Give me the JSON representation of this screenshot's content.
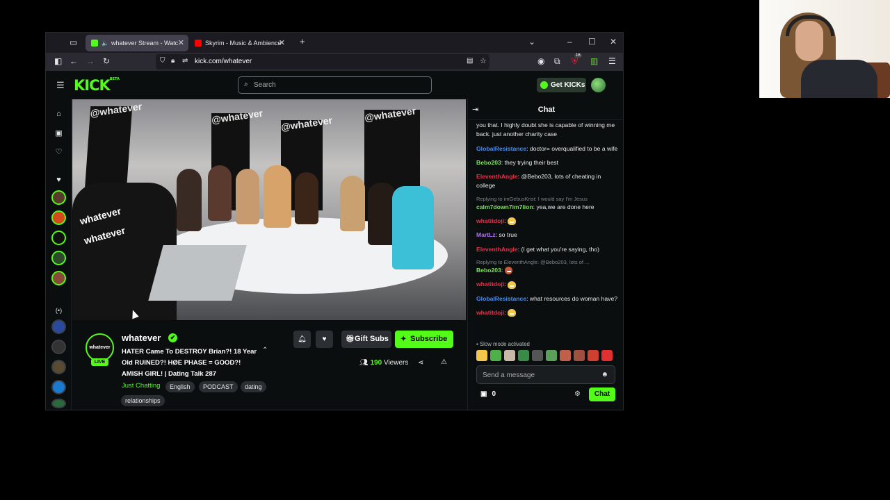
{
  "browser": {
    "tabs": [
      {
        "title": "whatever Stream - Watch L",
        "favicon_color": "#53fc18",
        "active": true
      },
      {
        "title": "Skyrim - Music & Ambience - N",
        "favicon_color": "#ff0000",
        "active": false
      }
    ],
    "new_tab_label": "+",
    "url": "kick.com/whatever",
    "extension_badge": "16"
  },
  "kick": {
    "logo": "KICK",
    "logo_tag": "BETA",
    "search_placeholder": "Search",
    "get_kicks_label": "Get KICKs"
  },
  "video_overlay": {
    "wall_text": "@whatever"
  },
  "channel": {
    "avatar_text": "whatever",
    "live_label": "LIVE",
    "name": "whatever",
    "verified_glyph": "✔",
    "title": "HATER Came To DESTROY Brian?! 18 Year Old RUINED?! HØE PHASE = GOOD?! AMISH GIRL! | Dating Talk 287",
    "category": "Just Chatting",
    "tags": [
      "English",
      "PODCAST",
      "dating",
      "relationships"
    ],
    "viewers_count": "190",
    "viewers_label": "Viewers",
    "gift_subs_label": "Gift Subs",
    "subscribe_label": "Subscribe"
  },
  "chat": {
    "title": "Chat",
    "messages": [
      {
        "reply": "",
        "user": "",
        "user_color": "#e8eaea",
        "text": "you that. I highly doubt she is capable of winning me back. just another charity case",
        "emote": false
      },
      {
        "reply": "",
        "user": "GlobalResistance",
        "user_color": "#4d8ff0",
        "text": "doctor= overqualified to be a wife",
        "emote": false
      },
      {
        "reply": "",
        "user": "Bebo203",
        "user_color": "#7fe05c",
        "text": "they trying their best",
        "emote": false
      },
      {
        "reply": "",
        "user": "EleventhAngle",
        "user_color": "#ea2f4a",
        "text": "@Bebo203, lots of cheating in college",
        "emote": false
      },
      {
        "reply": "Replying to imGebusKrist: I would say I'm Jesus",
        "user": "calm7down7im7lion",
        "user_color": "#7fe05c",
        "text": "yea,we are done here",
        "emote": false
      },
      {
        "reply": "",
        "user": "whatitdoji",
        "user_color": "#ea2f4a",
        "text": "",
        "emote": true
      },
      {
        "reply": "",
        "user": "MartLz",
        "user_color": "#b06df0",
        "text": "so true",
        "emote": false
      },
      {
        "reply": "",
        "user": "EleventhAngle",
        "user_color": "#ea2f4a",
        "text": "(I get what you're saying, tho)",
        "emote": false
      },
      {
        "reply": "Replying to EleventhAngle: @Bebo203, lots of ...",
        "user": "Bebo203",
        "user_color": "#7fe05c",
        "text": "",
        "emote": false
      },
      {
        "reply": "",
        "user": "whatitdoji",
        "user_color": "#ea2f4a",
        "text": "",
        "emote": true
      },
      {
        "reply": "",
        "user": "GlobalResistance",
        "user_color": "#4d8ff0",
        "text": "what resources do woman have?",
        "emote": false
      },
      {
        "reply": "",
        "user": "whatitdoji",
        "user_color": "#ea2f4a",
        "text": "",
        "emote": true
      }
    ],
    "slow_mode": "Slow mode activated",
    "input_placeholder": "Send a message",
    "kicks_count": "0",
    "send_label": "Chat"
  },
  "colors": {
    "accent": "#53fc18",
    "background": "#0b0e0f"
  }
}
